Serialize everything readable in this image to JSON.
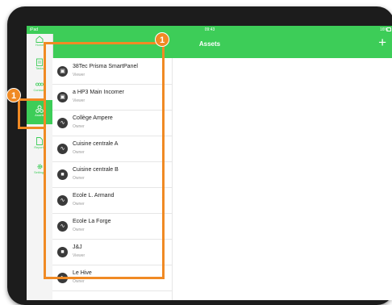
{
  "status_bar": {
    "carrier": "iPad",
    "time": "09:43",
    "battery": "16%"
  },
  "header": {
    "title": "Assets",
    "add_icon": "plus-icon"
  },
  "sidebar": {
    "items": [
      {
        "label": "Home",
        "icon": "home-icon"
      },
      {
        "label": "Tasks",
        "icon": "clipboard-icon"
      },
      {
        "label": "Contacts",
        "icon": "contacts-icon"
      },
      {
        "label": "Assets",
        "icon": "assets-icon",
        "active": true
      },
      {
        "label": "Reports",
        "icon": "reports-icon"
      },
      {
        "label": "Settings",
        "icon": "gear-icon"
      }
    ]
  },
  "assets": [
    {
      "name": "38Tec Prisma SmartPanel",
      "role": "Viewer"
    },
    {
      "name": "a HP3 Main Incomer",
      "role": "Viewer"
    },
    {
      "name": "Collège Ampere",
      "role": "Owner"
    },
    {
      "name": "Cuisine centrale A",
      "role": "Owner"
    },
    {
      "name": "Cuisine centrale B",
      "role": "Owner"
    },
    {
      "name": "Ecole L. Armand",
      "role": "Owner"
    },
    {
      "name": "Ecole La Forge",
      "role": "Owner"
    },
    {
      "name": "J&J",
      "role": "Viewer"
    },
    {
      "name": "Le Hive",
      "role": "Owner"
    }
  ],
  "callouts": {
    "sidebar_badge": "1",
    "list_badge": "1"
  },
  "colors": {
    "accent": "#3dcd58",
    "callout": "#f08a24"
  }
}
